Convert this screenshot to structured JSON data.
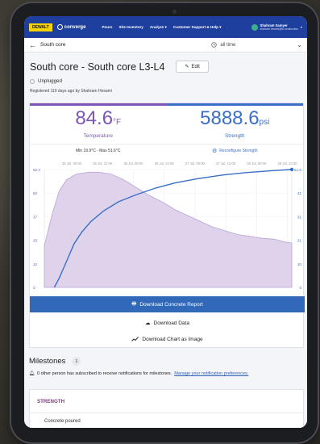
{
  "nav": {
    "brand": "DEWALT",
    "product": "converge",
    "links": [
      "Pours",
      "Site Inventory",
      "Analyze",
      "Customer Support & Help"
    ],
    "user_name": "Shahram Samyer",
    "user_sub": "shahram.hesami@tk.construction"
  },
  "subheader": {
    "back_label": "South core",
    "range_label": "all time"
  },
  "sensor": {
    "title": "South core - South core L3-L4",
    "edit_label": "Edit",
    "status": "Unplugged",
    "registered": "Registered 119 days ago by Shahram Hesami"
  },
  "metrics": {
    "temp_value": "84.6",
    "temp_unit": "°F",
    "temp_label": "Temperature",
    "strength_value": "5888.6",
    "strength_unit": "psi",
    "strength_label": "Strength",
    "minmax": "Min 19.9°C - Max 51.6°C",
    "reconfigure_label": "Reconfigure Strength"
  },
  "chart_data": {
    "type": "line",
    "x": [
      "25 Jul, 00:00",
      "25 Jul, 12:00",
      "26 Jul, 00:00",
      "26 Jul, 12:00",
      "27 Jul, 00:00",
      "27 Jul, 12:00",
      "28 Jul, 00:00",
      "28 Jul, 12:00"
    ],
    "left_ticks": [
      "62.4",
      "50",
      "37",
      "25",
      "12",
      "0"
    ],
    "right_ticks": [
      "51.6",
      "41",
      "31",
      "21",
      "10",
      "0"
    ],
    "left_ylim": [
      0,
      62.4
    ],
    "right_ylim": [
      0,
      51.6
    ],
    "series": [
      {
        "type": "area",
        "color": "#7b56b8",
        "points": [
          [
            0,
            22
          ],
          [
            0.03,
            38
          ],
          [
            0.06,
            51
          ],
          [
            0.09,
            57
          ],
          [
            0.13,
            60
          ],
          [
            0.18,
            61
          ],
          [
            0.22,
            61
          ],
          [
            0.27,
            60
          ],
          [
            0.32,
            57
          ],
          [
            0.37,
            53
          ],
          [
            0.42,
            49
          ],
          [
            0.48,
            45
          ],
          [
            0.53,
            41
          ],
          [
            0.58,
            38
          ],
          [
            0.63,
            35
          ],
          [
            0.68,
            32
          ],
          [
            0.73,
            30
          ],
          [
            0.78,
            28
          ],
          [
            0.83,
            27
          ],
          [
            0.88,
            26
          ],
          [
            0.93,
            25.5
          ],
          [
            0.97,
            24
          ],
          [
            1,
            23.5
          ]
        ]
      },
      {
        "type": "line",
        "color": "#3b6fc7",
        "points": [
          [
            0.04,
            0
          ],
          [
            0.06,
            4
          ],
          [
            0.08,
            9
          ],
          [
            0.1,
            14
          ],
          [
            0.12,
            19
          ],
          [
            0.15,
            24
          ],
          [
            0.19,
            29
          ],
          [
            0.24,
            33.5
          ],
          [
            0.3,
            37.5
          ],
          [
            0.37,
            40.5
          ],
          [
            0.45,
            43.5
          ],
          [
            0.53,
            45.8
          ],
          [
            0.62,
            47.6
          ],
          [
            0.72,
            49.2
          ],
          [
            0.82,
            50.3
          ],
          [
            0.92,
            51.1
          ],
          [
            1,
            51.6
          ]
        ]
      }
    ],
    "grid": true
  },
  "downloads": {
    "report": "Download Concrete Report",
    "data": "Download Data",
    "chart": "Download Chart as Image"
  },
  "milestones": {
    "title": "Milestones",
    "count": "1",
    "note": "0 other person has subscribed to receive notifications for milestones.",
    "note_link": "Manage your notification preferences.",
    "section": "STRENGTH",
    "item": "Concrete poured"
  }
}
